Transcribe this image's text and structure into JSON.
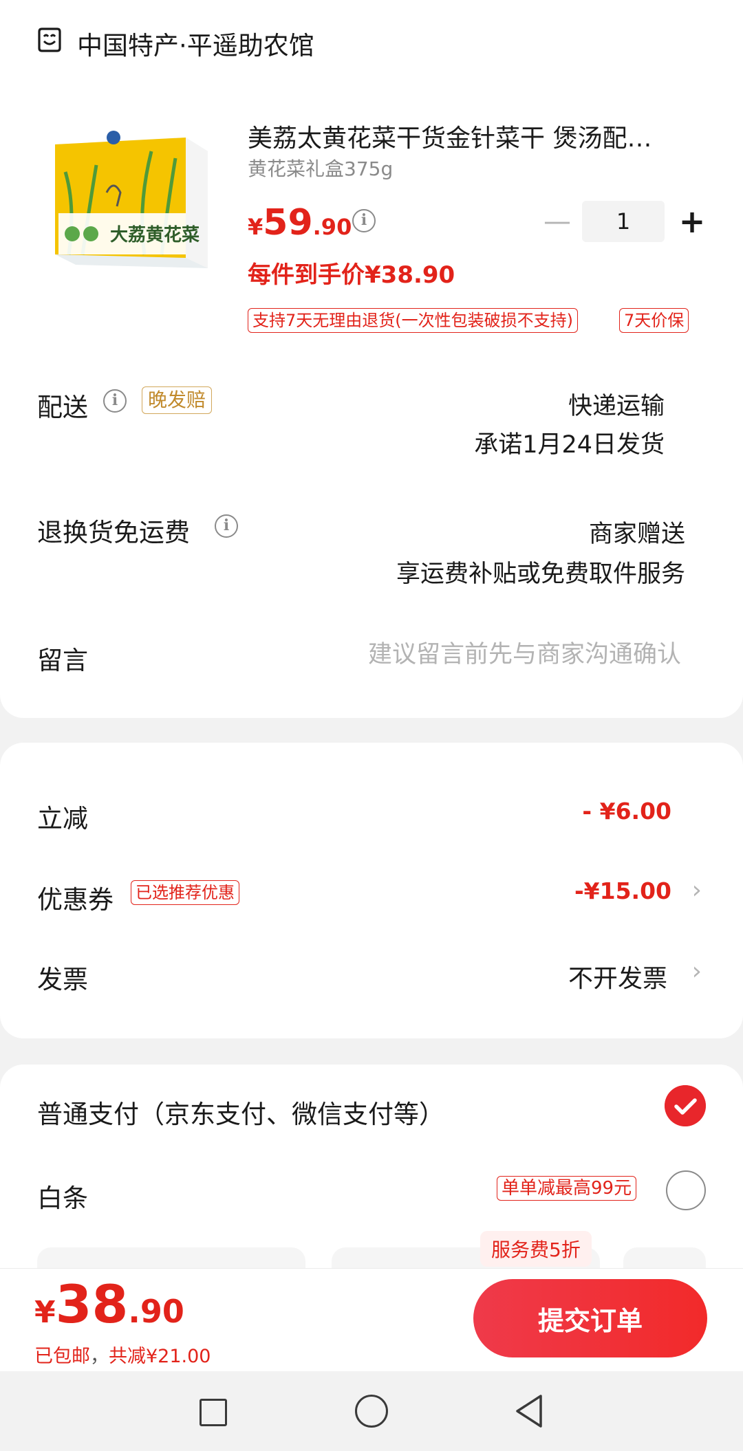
{
  "shop": {
    "name": "中国特产·平遥助农馆",
    "icon": "shop-icon"
  },
  "product": {
    "title": "美荔太黄花菜干货金针菜干 煲汤配…",
    "spec": "黄花菜礼盒375g",
    "image_text": "大荔黄花菜",
    "price_symbol": "¥",
    "price_int": "59",
    "price_dec": ".90",
    "quantity": "1",
    "final_price_text": "每件到手价¥38.90",
    "tags": [
      "支持7天无理由退货(一次性包装破损不支持)",
      "7天价保"
    ]
  },
  "delivery": {
    "label": "配送",
    "late_tag": "晚发赔",
    "method": "快递运输",
    "promise": "承诺1月24日发货"
  },
  "returns": {
    "label": "退换货免运费",
    "by": "商家赠送",
    "desc": "享运费补贴或免费取件服务"
  },
  "note": {
    "label": "留言",
    "placeholder": "建议留言前先与商家沟通确认"
  },
  "discounts": {
    "instant_label": "立减",
    "instant_value": "- ¥6.00",
    "coupon_label": "优惠券",
    "coupon_tag": "已选推荐优惠",
    "coupon_value": "-¥15.00",
    "invoice_label": "发票",
    "invoice_value": "不开发票"
  },
  "payment": {
    "option1": "普通支付（京东支付、微信支付等）",
    "option1_selected": true,
    "option2": "白条",
    "option2_tag": "单单减最高99元",
    "service_badge": "服务费5折"
  },
  "footer": {
    "total_symbol": "¥",
    "total_int": "38",
    "total_dec": ".90",
    "shipping": "已包邮",
    "sep": "，",
    "saved": "共减¥21.00",
    "submit": "提交订单"
  },
  "colors": {
    "accent": "#e2231a",
    "gold": "#c18a2c",
    "check": "#e8262b"
  }
}
